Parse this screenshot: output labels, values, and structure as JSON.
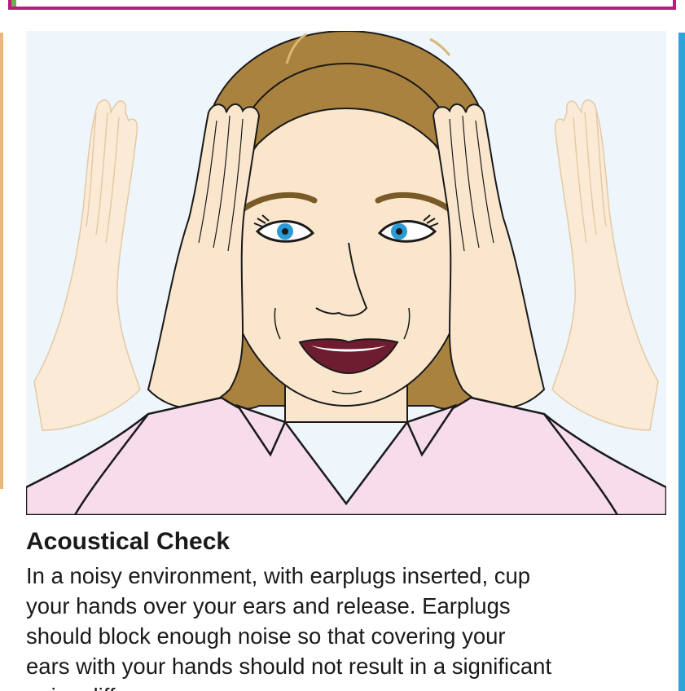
{
  "section": {
    "heading": "Acoustical Check",
    "body": "In a noisy environment, with earplugs inserted, cup\nyour hands over your ears and release. Earplugs\nshould block enough noise so that covering your\nears with your hands should not result in a significant\nnoise difference."
  },
  "illustration": {
    "subject": "woman-cupping-hands-over-ears",
    "colors": {
      "background": "#eef5fb",
      "skin": "#fae6cc",
      "hair": "#a9823f",
      "shirt": "#f7dcec",
      "eyes": "#2b9ad6",
      "lips": "#6e1c30",
      "outline": "#1a1a1a",
      "ghost_hand": "#fbebd6"
    }
  },
  "accents": {
    "banner_border": "#c2187a",
    "right_strip": "#2aa4db",
    "left_tab": "#6ab04c"
  }
}
